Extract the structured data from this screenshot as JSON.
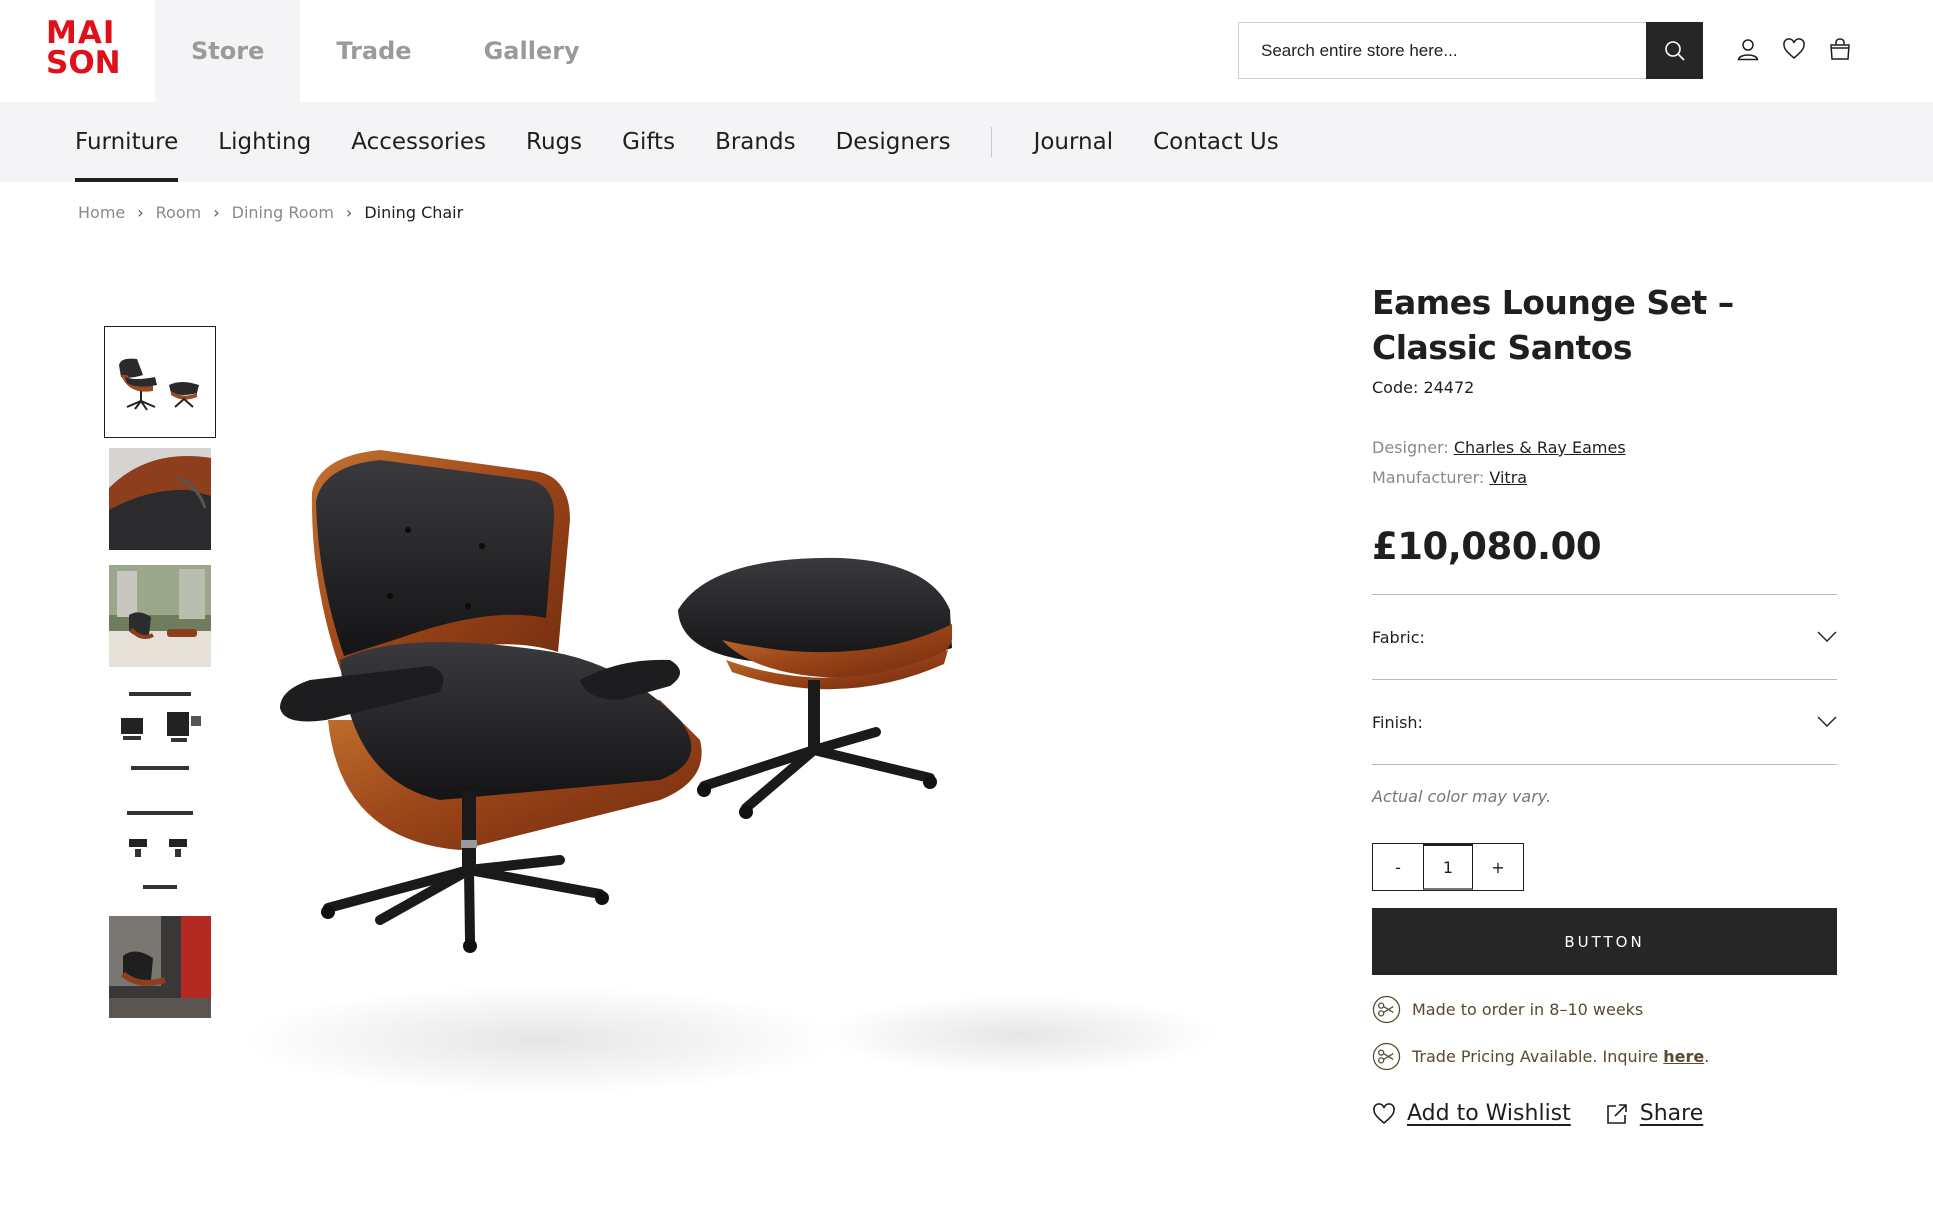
{
  "brand": {
    "logo_line1": "MAI",
    "logo_line2": "SON",
    "color": "#e0101a"
  },
  "topnav": {
    "items": [
      "Store",
      "Trade",
      "Gallery"
    ],
    "active": "Store"
  },
  "search": {
    "placeholder": "Search entire store here..."
  },
  "header_icons": [
    "user-icon",
    "heart-icon",
    "bag-icon"
  ],
  "categories": {
    "items": [
      "Furniture",
      "Lighting",
      "Accessories",
      "Rugs",
      "Gifts",
      "Brands",
      "Designers"
    ],
    "secondary": [
      "Journal",
      "Contact Us"
    ],
    "active": "Furniture"
  },
  "breadcrumb": [
    "Home",
    "Room",
    "Dining Room",
    "Dining Chair"
  ],
  "gallery": {
    "thumbnail_count": 6,
    "active_index": 0
  },
  "product": {
    "title": "Eames Lounge Set – Classic Santos",
    "code": "Code: 24472",
    "designer_label": "Designer:",
    "designer": "Charles & Ray Eames",
    "manufacturer_label": "Manufacturer:",
    "manufacturer": "Vitra",
    "price": "£10,080.00",
    "options": [
      "Fabric:",
      "Finish:"
    ],
    "note": "Actual color may vary.",
    "quantity": {
      "minus": "-",
      "value": "1",
      "plus": "+"
    },
    "button": "BUTTON",
    "lead_time": "Made to order in 8–10 weeks",
    "trade_text": "Trade Pricing Available. Inquire ",
    "trade_link": "here",
    "trade_suffix": ".",
    "wishlist": "Add to Wishlist",
    "share": "Share"
  },
  "colors": {
    "dark": "#262626",
    "muted": "#8a8a8a",
    "gold": "#5a4a2e",
    "catbar_bg": "#f4f4f6"
  }
}
